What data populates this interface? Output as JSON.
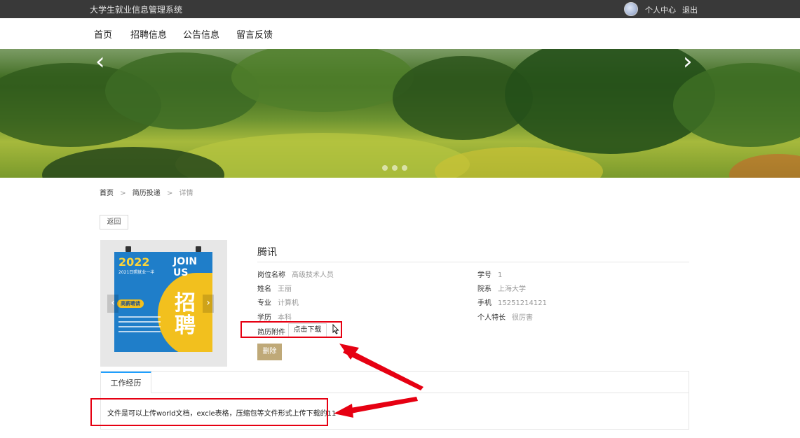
{
  "header": {
    "site_title": "大学生就业信息管理系统",
    "user_center": "个人中心",
    "logout": "退出"
  },
  "nav": {
    "items": [
      "首页",
      "招聘信息",
      "公告信息",
      "留言反馈"
    ]
  },
  "banner": {
    "prev": "‹",
    "next": "›"
  },
  "breadcrumb": {
    "home": "首页",
    "section": "简历投递",
    "current": "详情",
    "sep": ">"
  },
  "actions": {
    "back": "返回",
    "delete": "删除",
    "download": "点击下载"
  },
  "poster": {
    "year": "2022",
    "join": "JOIN US",
    "sub": "2021日照就业一半",
    "tag": "高薪聘请",
    "big": "招聘"
  },
  "detail": {
    "company": "腾讯",
    "left": [
      {
        "label": "岗位名称",
        "value": "高级技术人员"
      },
      {
        "label": "姓名",
        "value": "王丽"
      },
      {
        "label": "专业",
        "value": "计算机"
      },
      {
        "label": "学历",
        "value": "本科"
      }
    ],
    "right": [
      {
        "label": "学号",
        "value": "1"
      },
      {
        "label": "院系",
        "value": "上海大学"
      },
      {
        "label": "手机",
        "value": "15251214121"
      },
      {
        "label": "个人特长",
        "value": "很厉害"
      }
    ],
    "attachment_label": "简历附件"
  },
  "tabs": {
    "work_label": "工作经历",
    "work_content": "文件是可以上传world文档，excle表格，压缩包等文件形式上传下载的11"
  },
  "colors": {
    "topbar": "#393939",
    "highlight_red": "#e60012",
    "delete_btn": "#bfa978",
    "tab_accent": "#1e9fff"
  }
}
